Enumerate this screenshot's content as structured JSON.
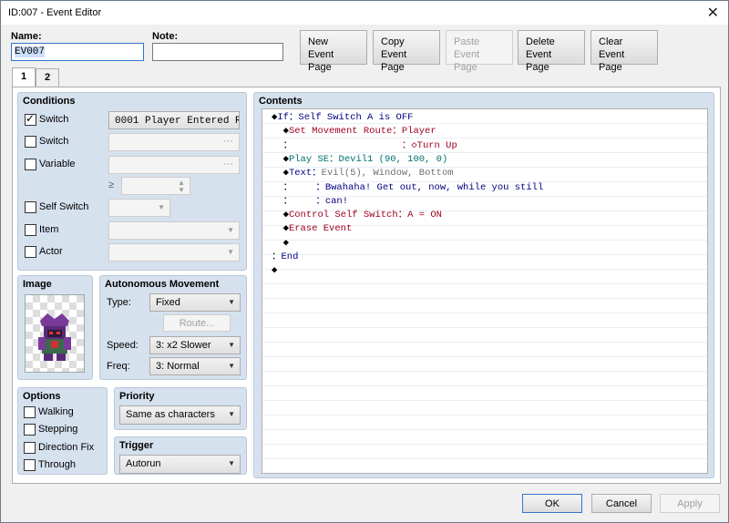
{
  "window": {
    "title": "ID:007 - Event Editor"
  },
  "name_label": "Name:",
  "name_value": "EV007",
  "note_label": "Note:",
  "note_value": "",
  "page_buttons": [
    {
      "label1": "New",
      "label2": "Event Page"
    },
    {
      "label1": "Copy",
      "label2": "Event Page"
    },
    {
      "label1": "Paste",
      "label2": "Event Page"
    },
    {
      "label1": "Delete",
      "label2": "Event Page"
    },
    {
      "label1": "Clear",
      "label2": "Event Page"
    }
  ],
  "tabs": [
    "1",
    "2"
  ],
  "conditions": {
    "title": "Conditions",
    "rows": [
      {
        "label": "Switch",
        "checked": true,
        "value": "0001 Player Entered R···",
        "btn": "···"
      },
      {
        "label": "Switch",
        "checked": false,
        "value": "",
        "btn": "···"
      },
      {
        "label": "Variable",
        "checked": false,
        "value": "",
        "btn": "···"
      },
      {
        "label": "Self Switch",
        "checked": false,
        "value": ""
      },
      {
        "label": "Item",
        "checked": false,
        "value": ""
      },
      {
        "label": "Actor",
        "checked": false,
        "value": ""
      }
    ],
    "ge_symbol": "≥"
  },
  "image": {
    "title": "Image"
  },
  "autonomous": {
    "title": "Autonomous Movement",
    "type_label": "Type:",
    "type_value": "Fixed",
    "route_label": "Route...",
    "speed_label": "Speed:",
    "speed_value": "3: x2 Slower",
    "freq_label": "Freq:",
    "freq_value": "3: Normal"
  },
  "options": {
    "title": "Options",
    "items": [
      "Walking",
      "Stepping",
      "Direction Fix",
      "Through"
    ]
  },
  "priority": {
    "title": "Priority",
    "value": "Same as characters"
  },
  "trigger": {
    "title": "Trigger",
    "value": "Autorun"
  },
  "contents": {
    "title": "Contents",
    "lines": [
      {
        "indent": "◆",
        "parts": [
          [
            "If：Self Switch A is OFF",
            "blue"
          ]
        ]
      },
      {
        "indent": "  ◆",
        "parts": [
          [
            "Set Movement Route：Player",
            "red"
          ]
        ]
      },
      {
        "indent": "  ：",
        "parts": [
          [
            "                   ：◇Turn Up",
            "red"
          ]
        ]
      },
      {
        "indent": "  ◆",
        "parts": [
          [
            "Play SE：Devil1 (90, 100, 0)",
            "teal"
          ]
        ]
      },
      {
        "indent": "  ◆",
        "parts": [
          [
            "Text：",
            "blue"
          ],
          [
            "Evil(5), Window, Bottom",
            "gray"
          ]
        ]
      },
      {
        "indent": "  ：",
        "parts": [
          [
            "    ：Bwahaha! Get out, now, while you still",
            "blue"
          ]
        ]
      },
      {
        "indent": "  ：",
        "parts": [
          [
            "    ：can!",
            "blue"
          ]
        ]
      },
      {
        "indent": "  ◆",
        "parts": [
          [
            "Control Self Switch：A = ON",
            "red"
          ]
        ]
      },
      {
        "indent": "  ◆",
        "parts": [
          [
            "Erase Event",
            "red"
          ]
        ]
      },
      {
        "indent": "  ◆",
        "parts": [
          [
            "",
            "black"
          ]
        ]
      },
      {
        "indent": "：",
        "parts": [
          [
            "End",
            "blue"
          ]
        ]
      },
      {
        "indent": "◆",
        "parts": [
          [
            "",
            "black"
          ]
        ]
      }
    ]
  },
  "footer": {
    "ok": "OK",
    "cancel": "Cancel",
    "apply": "Apply"
  },
  "colors": {
    "accent": "#3377cc",
    "group_bg": "#d6e1ee",
    "blue": "#000080",
    "red": "#a00020",
    "teal": "#007070",
    "gray": "#707070"
  }
}
